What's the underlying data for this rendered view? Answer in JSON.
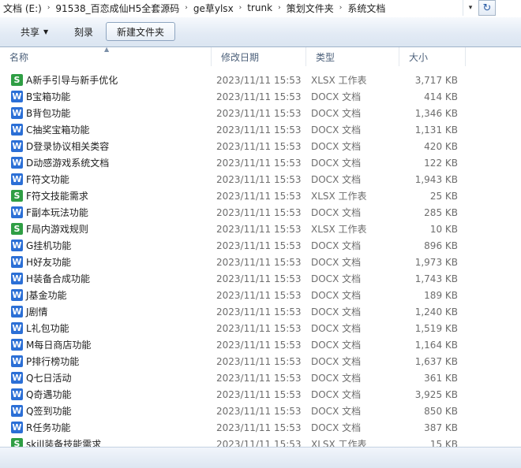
{
  "address": {
    "crumbs": [
      "文档 (E:)",
      "91538_百恋成仙H5全套源码",
      "ge草ylsx",
      "trunk",
      "策划文件夹",
      "系统文档"
    ],
    "separator": "›",
    "dropdown": "▾",
    "refresh": "↻"
  },
  "toolbar": {
    "share_label": "共享",
    "burn_label": "刻录",
    "new_folder_label": "新建文件夹"
  },
  "columns": {
    "name": "名称",
    "date": "修改日期",
    "type": "类型",
    "size": "大小"
  },
  "files": [
    {
      "icon": "S",
      "kind": "xlsx",
      "name": "A新手引导与新手优化",
      "date": "2023/11/11 15:53",
      "type": "XLSX 工作表",
      "size": "3,717 KB"
    },
    {
      "icon": "W",
      "kind": "docx",
      "name": "B宝箱功能",
      "date": "2023/11/11 15:53",
      "type": "DOCX 文档",
      "size": "414 KB"
    },
    {
      "icon": "W",
      "kind": "docx",
      "name": "B背包功能",
      "date": "2023/11/11 15:53",
      "type": "DOCX 文档",
      "size": "1,346 KB"
    },
    {
      "icon": "W",
      "kind": "docx",
      "name": "C抽奖宝箱功能",
      "date": "2023/11/11 15:53",
      "type": "DOCX 文档",
      "size": "1,131 KB"
    },
    {
      "icon": "W",
      "kind": "docx",
      "name": "D登录协议相关类容",
      "date": "2023/11/11 15:53",
      "type": "DOCX 文档",
      "size": "420 KB"
    },
    {
      "icon": "W",
      "kind": "docx",
      "name": "D动感游戏系统文档",
      "date": "2023/11/11 15:53",
      "type": "DOCX 文档",
      "size": "122 KB"
    },
    {
      "icon": "W",
      "kind": "docx",
      "name": "F符文功能",
      "date": "2023/11/11 15:53",
      "type": "DOCX 文档",
      "size": "1,943 KB"
    },
    {
      "icon": "S",
      "kind": "xlsx",
      "name": "F符文技能需求",
      "date": "2023/11/11 15:53",
      "type": "XLSX 工作表",
      "size": "25 KB"
    },
    {
      "icon": "W",
      "kind": "docx",
      "name": "F副本玩法功能",
      "date": "2023/11/11 15:53",
      "type": "DOCX 文档",
      "size": "285 KB"
    },
    {
      "icon": "S",
      "kind": "xlsx",
      "name": "F局内游戏规则",
      "date": "2023/11/11 15:53",
      "type": "XLSX 工作表",
      "size": "10 KB"
    },
    {
      "icon": "W",
      "kind": "docx",
      "name": "G挂机功能",
      "date": "2023/11/11 15:53",
      "type": "DOCX 文档",
      "size": "896 KB"
    },
    {
      "icon": "W",
      "kind": "docx",
      "name": "H好友功能",
      "date": "2023/11/11 15:53",
      "type": "DOCX 文档",
      "size": "1,973 KB"
    },
    {
      "icon": "W",
      "kind": "docx",
      "name": "H装备合成功能",
      "date": "2023/11/11 15:53",
      "type": "DOCX 文档",
      "size": "1,743 KB"
    },
    {
      "icon": "W",
      "kind": "docx",
      "name": "J基金功能",
      "date": "2023/11/11 15:53",
      "type": "DOCX 文档",
      "size": "189 KB"
    },
    {
      "icon": "W",
      "kind": "docx",
      "name": "J剧情",
      "date": "2023/11/11 15:53",
      "type": "DOCX 文档",
      "size": "1,240 KB"
    },
    {
      "icon": "W",
      "kind": "docx",
      "name": "L礼包功能",
      "date": "2023/11/11 15:53",
      "type": "DOCX 文档",
      "size": "1,519 KB"
    },
    {
      "icon": "W",
      "kind": "docx",
      "name": "M每日商店功能",
      "date": "2023/11/11 15:53",
      "type": "DOCX 文档",
      "size": "1,164 KB"
    },
    {
      "icon": "W",
      "kind": "docx",
      "name": "P排行榜功能",
      "date": "2023/11/11 15:53",
      "type": "DOCX 文档",
      "size": "1,637 KB"
    },
    {
      "icon": "W",
      "kind": "docx",
      "name": "Q七日活动",
      "date": "2023/11/11 15:53",
      "type": "DOCX 文档",
      "size": "361 KB"
    },
    {
      "icon": "W",
      "kind": "docx",
      "name": "Q奇遇功能",
      "date": "2023/11/11 15:53",
      "type": "DOCX 文档",
      "size": "3,925 KB"
    },
    {
      "icon": "W",
      "kind": "docx",
      "name": "Q签到功能",
      "date": "2023/11/11 15:53",
      "type": "DOCX 文档",
      "size": "850 KB"
    },
    {
      "icon": "W",
      "kind": "docx",
      "name": "R任务功能",
      "date": "2023/11/11 15:53",
      "type": "DOCX 文档",
      "size": "387 KB"
    },
    {
      "icon": "S",
      "kind": "xlsx",
      "name": "skill装备技能需求",
      "date": "2023/11/11 15:53",
      "type": "XLSX 工作表",
      "size": "15 KB"
    }
  ]
}
